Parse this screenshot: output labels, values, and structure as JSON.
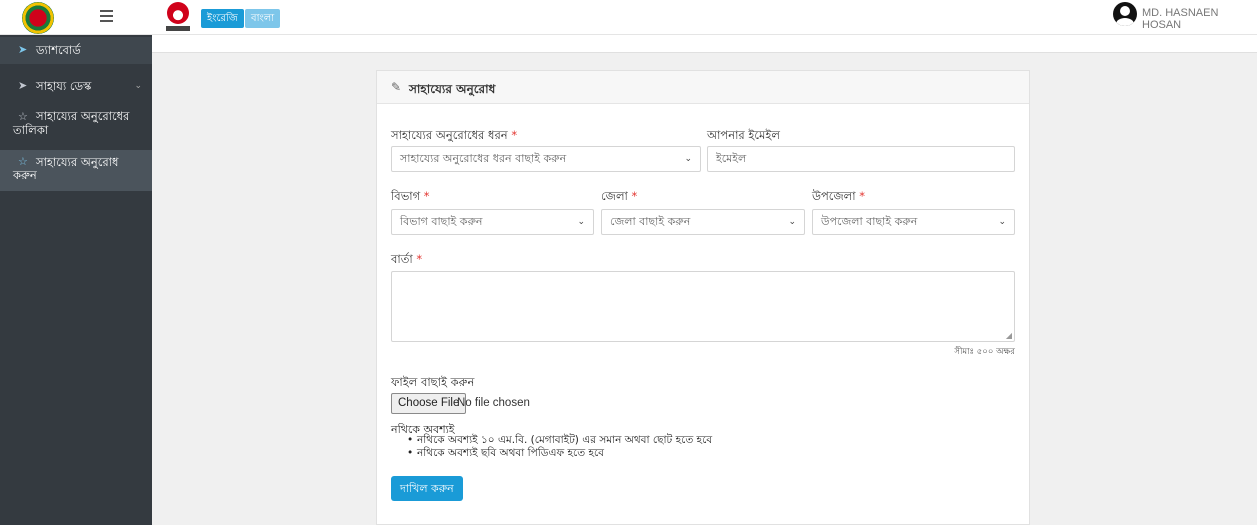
{
  "header": {
    "lang_en": "ইংরেজি",
    "lang_bn": "বাংলা",
    "user_name": "MD. HASNAEN HOSAN"
  },
  "sidebar": {
    "items": [
      {
        "label": "ড্যাশবোর্ড",
        "icon": "send-icon"
      },
      {
        "label": "সাহায্য ডেস্ক",
        "icon": "send-icon"
      },
      {
        "label": "সাহায্যের অনুরোধের",
        "label2": "তালিকা",
        "icon": "star-icon"
      },
      {
        "label": "সাহায্যের অনুরোধ",
        "label2": "করুন",
        "icon": "star-icon"
      }
    ]
  },
  "form": {
    "title": "সাহায্যের অনুরোধ",
    "request_type_label": "সাহায্যের অনুরোধের ধরন",
    "request_type_placeholder": "সাহায্যের অনুরোধের ধরন বাছাই করুন",
    "email_label": "আপনার ইমেইল",
    "email_placeholder": "ইমেইল",
    "division_label": "বিভাগ",
    "division_placeholder": "বিভাগ বাছাই করুন",
    "district_label": "জেলা",
    "district_placeholder": "জেলা বাছাই করুন",
    "upazila_label": "উপজেলা",
    "upazila_placeholder": "উপজেলা বাছাই করুন",
    "message_label": "বার্তা",
    "message_limit": "সীমাঃ ৫০০ অক্ষর",
    "file_label": "ফাইল বাছাই করুন",
    "file_button": "Choose File",
    "file_status": "No file chosen",
    "note_title": "নথিকে অবশ্যই",
    "notes": [
      "নথিকে অবশ্যই ১০ এম.বি. (মেগাবাইট) এর সমান অথবা ছোট হতে হবে",
      "নথিকে অবশ্যই ছবি অথবা পিডিএফ হতে হবে"
    ],
    "submit": "দাখিল করুন",
    "required_mark": "*"
  },
  "colors": {
    "sidebar_bg": "#343a40",
    "accent": "#1a9bd7",
    "required": "#e3342f"
  }
}
